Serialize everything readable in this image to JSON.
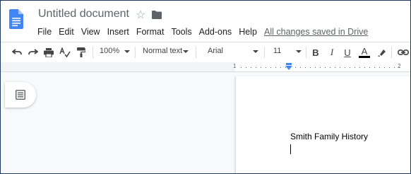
{
  "document": {
    "title": "Untitled document",
    "save_status": "All changes saved in Drive",
    "body_text": "Smith Family History"
  },
  "menu": [
    "File",
    "Edit",
    "View",
    "Insert",
    "Format",
    "Tools",
    "Add-ons",
    "Help"
  ],
  "toolbar": {
    "zoom": "100%",
    "style": "Normal text",
    "font": "Arial",
    "size": "11",
    "bold": "B",
    "italic": "I",
    "underline": "U",
    "text_color": "A"
  },
  "ruler": {
    "left_number": "1",
    "right_number": "2"
  },
  "colors": {
    "brand_blue": "#4285f4",
    "text_gray": "#5f6368"
  },
  "icons": [
    "docs-logo-icon",
    "star-icon",
    "folder-icon",
    "undo-icon",
    "redo-icon",
    "print-icon",
    "spellcheck-icon",
    "paint-format-icon",
    "highlight-icon",
    "link-icon",
    "outline-icon"
  ]
}
